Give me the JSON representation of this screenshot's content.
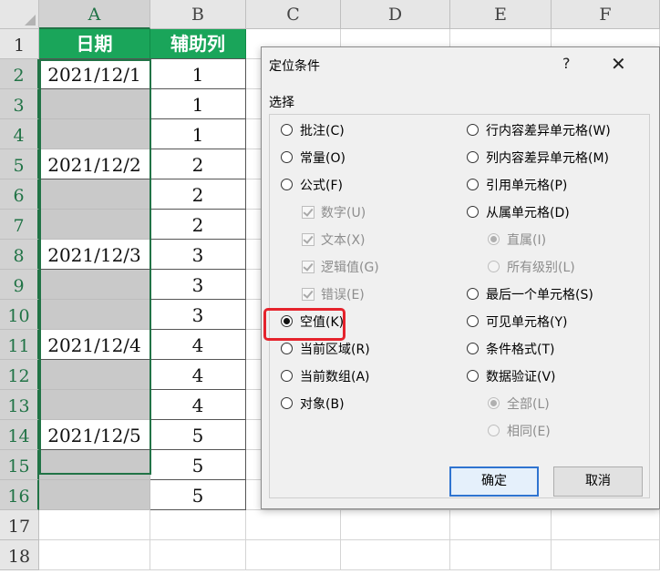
{
  "sheet": {
    "columns": [
      "A",
      "B",
      "C",
      "D",
      "E",
      "F"
    ],
    "rows": [
      "1",
      "2",
      "3",
      "4",
      "5",
      "6",
      "7",
      "8",
      "9",
      "10",
      "11",
      "12",
      "13",
      "14",
      "15",
      "16",
      "17",
      "18"
    ],
    "header": {
      "date": "日期",
      "helper": "辅助列"
    },
    "data": [
      {
        "date": "2021/12/1",
        "helper": "1"
      },
      {
        "date": "",
        "helper": "1"
      },
      {
        "date": "",
        "helper": "1"
      },
      {
        "date": "2021/12/2",
        "helper": "2"
      },
      {
        "date": "",
        "helper": "2"
      },
      {
        "date": "",
        "helper": "2"
      },
      {
        "date": "2021/12/3",
        "helper": "3"
      },
      {
        "date": "",
        "helper": "3"
      },
      {
        "date": "",
        "helper": "3"
      },
      {
        "date": "2021/12/4",
        "helper": "4"
      },
      {
        "date": "",
        "helper": "4"
      },
      {
        "date": "",
        "helper": "4"
      },
      {
        "date": "2021/12/5",
        "helper": "5"
      },
      {
        "date": "",
        "helper": "5"
      },
      {
        "date": "",
        "helper": "5"
      }
    ]
  },
  "dialog": {
    "title": "定位条件",
    "help": "?",
    "close": "✕",
    "section": "选择",
    "left_options": [
      {
        "label": "批注(C)",
        "type": "radio",
        "selected": false,
        "disabled": false
      },
      {
        "label": "常量(O)",
        "type": "radio",
        "selected": false,
        "disabled": false
      },
      {
        "label": "公式(F)",
        "type": "radio",
        "selected": false,
        "disabled": false
      },
      {
        "label": "数字(U)",
        "type": "checkbox",
        "checked": true,
        "disabled": true
      },
      {
        "label": "文本(X)",
        "type": "checkbox",
        "checked": true,
        "disabled": true
      },
      {
        "label": "逻辑值(G)",
        "type": "checkbox",
        "checked": true,
        "disabled": true
      },
      {
        "label": "错误(E)",
        "type": "checkbox",
        "checked": true,
        "disabled": true
      },
      {
        "label": "空值(K)",
        "type": "radio",
        "selected": true,
        "disabled": false
      },
      {
        "label": "当前区域(R)",
        "type": "radio",
        "selected": false,
        "disabled": false
      },
      {
        "label": "当前数组(A)",
        "type": "radio",
        "selected": false,
        "disabled": false
      },
      {
        "label": "对象(B)",
        "type": "radio",
        "selected": false,
        "disabled": false
      }
    ],
    "right_options": [
      {
        "label": "行内容差异单元格(W)",
        "type": "radio",
        "selected": false,
        "disabled": false
      },
      {
        "label": "列内容差异单元格(M)",
        "type": "radio",
        "selected": false,
        "disabled": false
      },
      {
        "label": "引用单元格(P)",
        "type": "radio",
        "selected": false,
        "disabled": false
      },
      {
        "label": "从属单元格(D)",
        "type": "radio",
        "selected": false,
        "disabled": false
      },
      {
        "label": "直属(I)",
        "type": "radio",
        "selected": true,
        "disabled": true
      },
      {
        "label": "所有级别(L)",
        "type": "radio",
        "selected": false,
        "disabled": true
      },
      {
        "label": "最后一个单元格(S)",
        "type": "radio",
        "selected": false,
        "disabled": false
      },
      {
        "label": "可见单元格(Y)",
        "type": "radio",
        "selected": false,
        "disabled": false
      },
      {
        "label": "条件格式(T)",
        "type": "radio",
        "selected": false,
        "disabled": false
      },
      {
        "label": "数据验证(V)",
        "type": "radio",
        "selected": false,
        "disabled": false
      },
      {
        "label": "全部(L)",
        "type": "radio",
        "selected": true,
        "disabled": true
      },
      {
        "label": "相同(E)",
        "type": "radio",
        "selected": false,
        "disabled": true
      }
    ],
    "ok_label": "确定",
    "cancel_label": "取消"
  },
  "colors": {
    "header_green": "#1aa55a",
    "selection_green": "#217346",
    "highlight_red": "#e5232c",
    "primary_button_border": "#2f74d0"
  }
}
